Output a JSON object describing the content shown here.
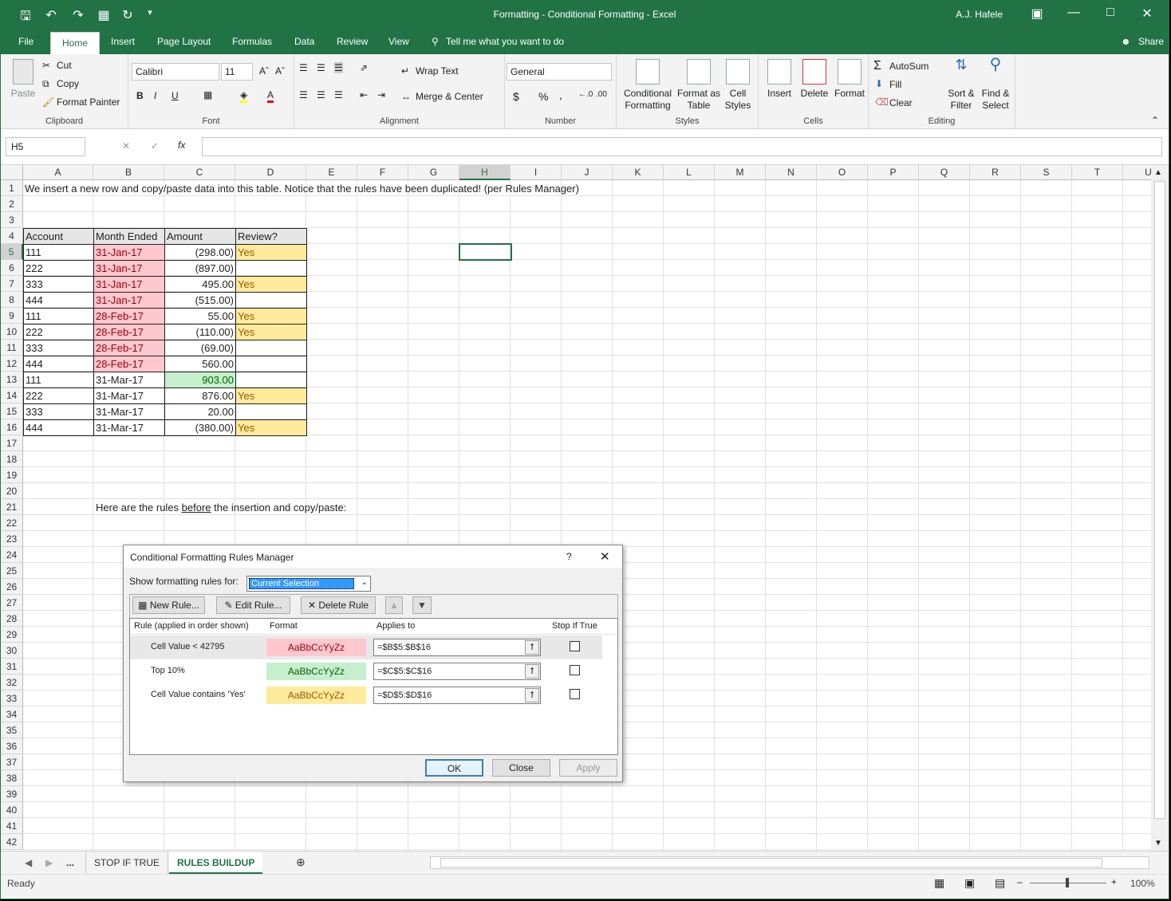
{
  "window": {
    "title": "Formatting - Conditional Formatting  -  Excel",
    "user": "A.J. Hafele"
  },
  "ribbon_tabs": [
    "File",
    "Home",
    "Insert",
    "Page Layout",
    "Formulas",
    "Data",
    "Review",
    "View"
  ],
  "tell_me": "Tell me what you want to do",
  "share": "Share",
  "clipboard": {
    "paste": "Paste",
    "cut": "Cut",
    "copy": "Copy",
    "format_painter": "Format Painter",
    "label": "Clipboard"
  },
  "font": {
    "name": "Calibri",
    "size": "11",
    "label": "Font",
    "bold": "B",
    "italic": "I",
    "underline": "U"
  },
  "alignment": {
    "wrap": "Wrap Text",
    "merge": "Merge & Center",
    "label": "Alignment"
  },
  "number": {
    "format": "General",
    "label": "Number",
    "currency": "$",
    "percent": "%",
    "comma": ","
  },
  "styles": {
    "cond1": "Conditional",
    "cond2": "Formatting",
    "table1": "Format as",
    "table2": "Table",
    "cell1": "Cell",
    "cell2": "Styles",
    "label": "Styles"
  },
  "cells": {
    "insert": "Insert",
    "delete": "Delete",
    "format": "Format",
    "label": "Cells"
  },
  "editing": {
    "autosum": "AutoSum",
    "fill": "Fill",
    "clear": "Clear",
    "sort1": "Sort &",
    "sort2": "Filter",
    "find1": "Find &",
    "find2": "Select",
    "label": "Editing"
  },
  "formula_bar": {
    "namebox": "H5",
    "fx": "fx",
    "value": ""
  },
  "columns": [
    "A",
    "B",
    "C",
    "D",
    "E",
    "F",
    "G",
    "H",
    "I",
    "J",
    "K",
    "L",
    "M",
    "N",
    "O",
    "P",
    "Q",
    "R",
    "S",
    "T",
    "U"
  ],
  "rows": [
    "1",
    "2",
    "3",
    "4",
    "5",
    "6",
    "7",
    "8",
    "9",
    "10",
    "11",
    "12",
    "13",
    "14",
    "15",
    "16",
    "17",
    "18",
    "19",
    "20",
    "21",
    "22",
    "23",
    "24",
    "25",
    "26",
    "27",
    "28",
    "29",
    "30",
    "31",
    "32",
    "33",
    "34",
    "35",
    "36",
    "37",
    "38",
    "39",
    "40",
    "41",
    "42"
  ],
  "sheet": {
    "row1": "We insert a new row and copy/paste data into this table.  Notice that the rules have been duplicated! (per Rules Manager)",
    "headers": [
      "Account",
      "Month Ended",
      "Amount",
      "Review?"
    ],
    "table": [
      [
        "111",
        "31-Jan-17",
        "(298.00)",
        "Yes"
      ],
      [
        "222",
        "31-Jan-17",
        "(897.00)",
        ""
      ],
      [
        "333",
        "31-Jan-17",
        "495.00",
        "Yes"
      ],
      [
        "444",
        "31-Jan-17",
        "(515.00)",
        ""
      ],
      [
        "111",
        "28-Feb-17",
        "55.00",
        "Yes"
      ],
      [
        "222",
        "28-Feb-17",
        "(110.00)",
        "Yes"
      ],
      [
        "333",
        "28-Feb-17",
        "(69.00)",
        ""
      ],
      [
        "444",
        "28-Feb-17",
        "560.00",
        ""
      ],
      [
        "111",
        "31-Mar-17",
        "903.00",
        ""
      ],
      [
        "222",
        "31-Mar-17",
        "876.00",
        "Yes"
      ],
      [
        "333",
        "31-Mar-17",
        "20.00",
        ""
      ],
      [
        "444",
        "31-Mar-17",
        "(380.00)",
        "Yes"
      ]
    ],
    "row21_pre": "Here are the rules ",
    "row21_u": "before",
    "row21_post": " the insertion and copy/paste:"
  },
  "dialog": {
    "title": "Conditional Formatting Rules Manager",
    "help": "?",
    "show_label": "Show formatting rules for:",
    "show_value": "Current Selection",
    "new_rule": "New Rule...",
    "edit_rule": "Edit Rule...",
    "delete_rule": "Delete Rule",
    "col_rule": "Rule (applied in order shown)",
    "col_format": "Format",
    "col_applies": "Applies to",
    "col_stop": "Stop If True",
    "rules": [
      {
        "rule": "Cell Value < 42795",
        "preview": "AaBbCcYyZz",
        "applies": "=$B$5:$B$16",
        "bg": "#ffc7ce",
        "fg": "#9c0006"
      },
      {
        "rule": "Top 10%",
        "preview": "AaBbCcYyZz",
        "applies": "=$C$5:$C$16",
        "bg": "#c6efce",
        "fg": "#006100"
      },
      {
        "rule": "Cell Value contains 'Yes'",
        "preview": "AaBbCcYyZz",
        "applies": "=$D$5:$D$16",
        "bg": "#ffeb9c",
        "fg": "#9c5700"
      }
    ],
    "ok": "OK",
    "close": "Close",
    "apply": "Apply"
  },
  "sheet_tabs": {
    "more": "...",
    "tab1": "STOP IF TRUE",
    "tab2": "RULES BUILDUP"
  },
  "status": {
    "ready": "Ready",
    "zoom": "100%"
  },
  "colors": {
    "excel_green": "#217346",
    "bad_fill": "#ffc7ce",
    "good_fill": "#c6efce",
    "neutral_fill": "#ffeb9c"
  }
}
